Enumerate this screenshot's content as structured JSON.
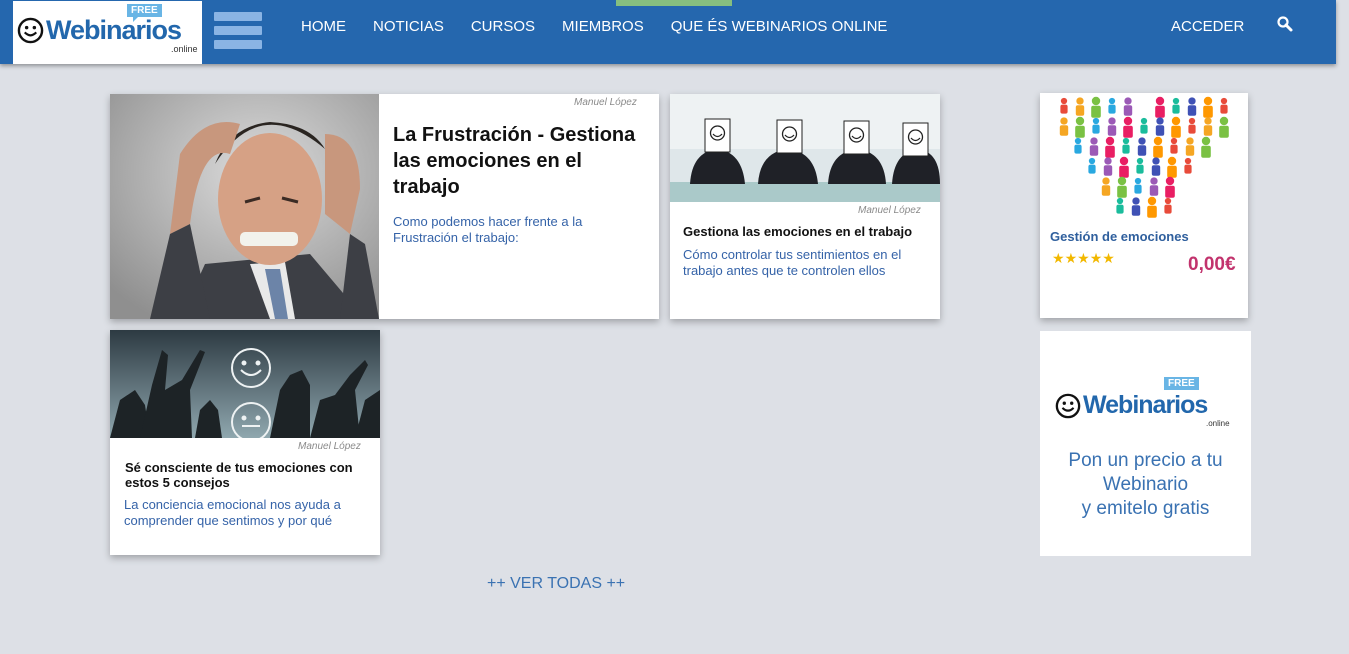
{
  "header": {
    "logo": {
      "word": "Webinarios",
      "free": "FREE",
      "online": ".online"
    },
    "nav": [
      "HOME",
      "NOTICIAS",
      "CURSOS",
      "MIEMBROS",
      "QUE ÉS WEBINARIOS ONLINE"
    ],
    "login_label": "ACCEDER"
  },
  "articles": [
    {
      "author": "Manuel López",
      "title": "La Frustración - Gestiona las emociones en el trabajo",
      "description": "Como podemos hacer frente a la Frustración el trabajo:"
    },
    {
      "author": "Manuel López",
      "title": "Gestiona las emociones en el trabajo",
      "description": "Cómo controlar tus sentimientos en el trabajo antes que te controlen ellos"
    },
    {
      "author": "Manuel López",
      "title": "Sé consciente de tus emociones con estos 5 consejos",
      "description": "La conciencia emocional nos ayuda a comprender que sentimos y por qué"
    }
  ],
  "course": {
    "title": "Gestión de emociones",
    "rating": 5,
    "price": "0,00€"
  },
  "promo": {
    "logo_word": "Webinarios",
    "free": "FREE",
    "online": ".online",
    "line1": "Pon un precio a tu",
    "line2": "Webinario",
    "line3": "y emitelo gratis"
  },
  "see_all_label": "++ VER TODAS ++",
  "colors": {
    "header": "#2567ae",
    "accent": "#3a72b2",
    "price": "#c2336d",
    "stars": "#f2b800"
  }
}
